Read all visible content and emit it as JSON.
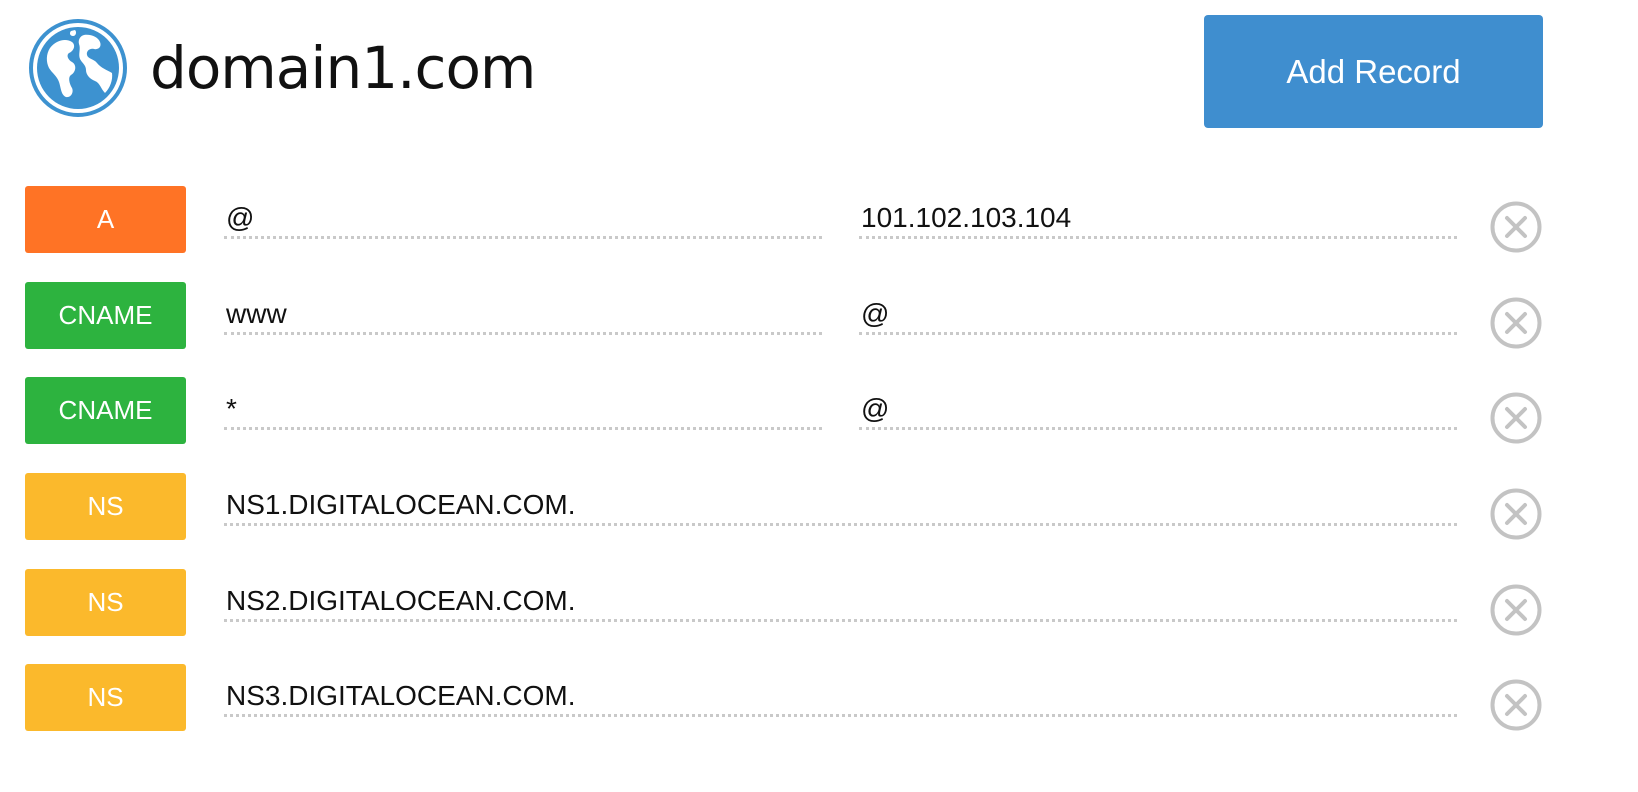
{
  "header": {
    "domain": "domain1.com",
    "icon": "globe-icon",
    "add_button_label": "Add Record"
  },
  "colors": {
    "A": "#ff7325",
    "CNAME": "#2db33f",
    "NS": "#fbb92c",
    "add_button": "#3f8ecf",
    "delete_icon": "#c3c3c3"
  },
  "records": [
    {
      "type": "A",
      "name": "@",
      "value": "101.102.103.104"
    },
    {
      "type": "CNAME",
      "name": "www",
      "value": "@"
    },
    {
      "type": "CNAME",
      "name": "*",
      "value": "@"
    },
    {
      "type": "NS",
      "value": "NS1.DIGITALOCEAN.COM."
    },
    {
      "type": "NS",
      "value": "NS2.DIGITALOCEAN.COM."
    },
    {
      "type": "NS",
      "value": "NS3.DIGITALOCEAN.COM."
    }
  ]
}
